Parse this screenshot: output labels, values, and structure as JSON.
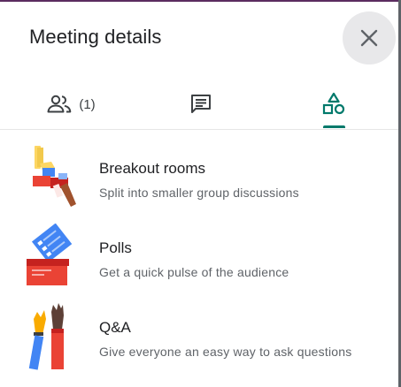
{
  "panel": {
    "title": "Meeting details"
  },
  "tabs": [
    {
      "id": "people",
      "icon": "people-icon",
      "count_label": "(1)"
    },
    {
      "id": "chat",
      "icon": "chat-icon"
    },
    {
      "id": "activities",
      "icon": "activities-shapes-icon",
      "active": true
    }
  ],
  "activities": [
    {
      "name": "Breakout rooms",
      "description": "Split into smaller group discussions",
      "icon": "breakout-rooms-illustration"
    },
    {
      "name": "Polls",
      "description": "Get a quick pulse of the audience",
      "icon": "polls-illustration"
    },
    {
      "name": "Q&A",
      "description": "Give everyone an easy way to ask questions",
      "icon": "qa-illustration"
    }
  ],
  "colors": {
    "accent": "#00796b",
    "close_bg": "#e8e8ea"
  }
}
